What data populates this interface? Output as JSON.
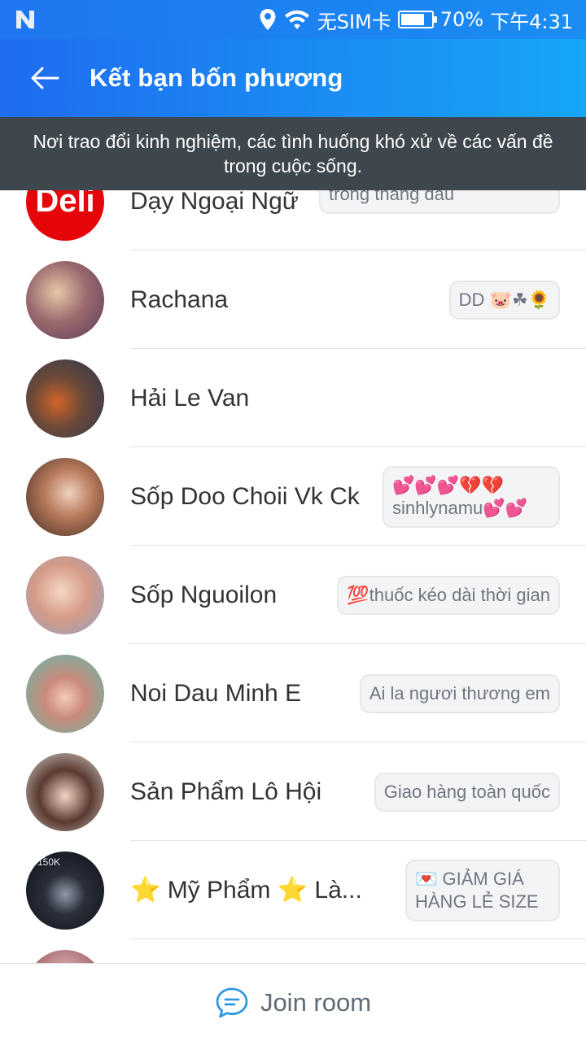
{
  "status_bar": {
    "network": "无SIM卡",
    "battery": "70%",
    "time": "下午4:31",
    "icons": [
      "n-icon",
      "location-icon",
      "wifi-icon",
      "battery-icon"
    ]
  },
  "header": {
    "title": "Kết bạn bốn phương",
    "back_icon": "arrow-left-icon"
  },
  "banner": {
    "text": "Nơi trao đổi kinh nghiệm, các tình huống khó xử về các vấn đề trong cuộc sống."
  },
  "members": [
    {
      "name": "Dạy Ngoại Ngữ",
      "status": "Miễn phí toàn bộ học phí trong tháng đầu",
      "avatar_text": "Deli",
      "avatar_color": "#e6060a"
    },
    {
      "name": "Rachana",
      "status": "DD 🐷☘🌻",
      "avatar_color": "#7a4a6a"
    },
    {
      "name": "Hải Le Van",
      "status": "",
      "avatar_color": "#5a4a3a"
    },
    {
      "name": "Sốp Doo Choii Vk Ck",
      "status": "💕💕💕💔💔 sinhlynamu💕💕",
      "avatar_color": "#8a5a40"
    },
    {
      "name": "Sốp Nguoilon",
      "status": "💯thuốc kéo dài thời gian",
      "avatar_color": "#c9a08a"
    },
    {
      "name": "Noi Dau Minh E",
      "status": "Ai la ngươi thương em",
      "avatar_color": "#66b4a4"
    },
    {
      "name": "Sản Phẩm Lô Hội",
      "status": "Giao hàng toàn quốc",
      "avatar_color": "#a8a29a"
    },
    {
      "name": "⭐ Mỹ Phẩm ⭐ Là...",
      "status": "💌 GIẢM GIÁ HÀNG LẺ SIZE",
      "avatar_text": "150K",
      "avatar_color": "#1a1a24"
    },
    {
      "name": "",
      "status": "",
      "avatar_color": "#b08080"
    }
  ],
  "bottom": {
    "join_label": "Join room",
    "chat_icon": "chat-bubble-icon"
  }
}
